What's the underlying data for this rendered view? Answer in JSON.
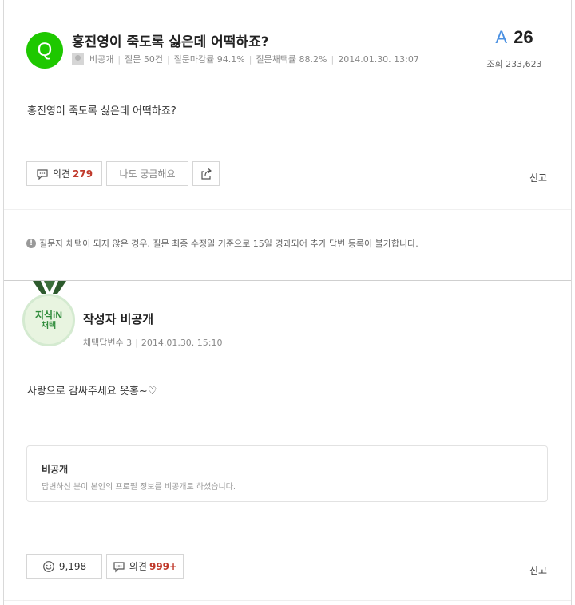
{
  "question": {
    "badge": "Q",
    "title": "홍진영이 죽도록 싫은데 어떡하죠?",
    "author": "비공개",
    "questions": "질문 50건",
    "deadline_rate": "질문마감률 94.1%",
    "adopt_rate": "질문채택률 88.2%",
    "date": "2014.01.30. 13:07",
    "body": "홍진영이 죽도록 싫은데 어떡하죠?",
    "answer_prefix": "A",
    "answer_count": "26",
    "views": "조회 233,623",
    "opinion_label": "의견",
    "opinion_count": "279",
    "curious_label": "나도 궁금해요",
    "report": "신고"
  },
  "notice": {
    "icon": "!",
    "text": "질문자 채택이 되지 않은 경우, 질문 최종 수정일 기준으로 15일 경과되어 추가 답변 등록이 불가합니다."
  },
  "answer": {
    "medal_line1": "지식iN",
    "medal_line2": "채택",
    "writer": "작성자 비공개",
    "adopted_count": "채택답변수 3",
    "date": "2014.01.30. 15:10",
    "body": "사랑으로 감싸주세요 옷홍~♡",
    "profile_title": "비공개",
    "profile_desc": "답변하신 분이 본인의 프로필 정보를 비공개로 하셨습니다.",
    "like_count": "9,198",
    "opinion_label": "의견",
    "opinion_count": "999+",
    "report": "신고"
  },
  "colors": {
    "naver_green": "#1ec800",
    "accent_red": "#c0392b",
    "answer_blue": "#4a90e2"
  }
}
